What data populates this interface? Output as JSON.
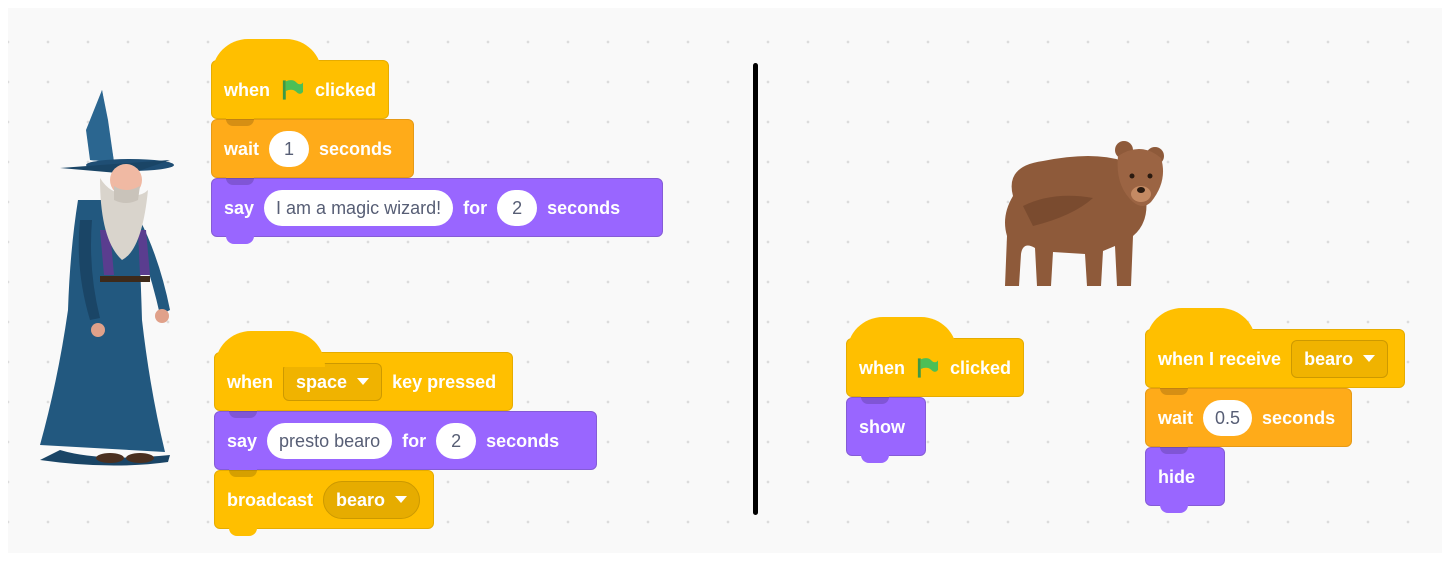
{
  "left_sprite": "wizard",
  "right_sprite": "bear",
  "scripts": {
    "wizard_flag": {
      "hat": {
        "pre": "when",
        "post": "clicked",
        "icon": "green-flag-icon"
      },
      "wait": {
        "label": "wait",
        "value": "1",
        "suffix": "seconds"
      },
      "say": {
        "label": "say",
        "text": "I am a magic wizard!",
        "for": "for",
        "secs": "2",
        "suffix": "seconds"
      }
    },
    "wizard_key": {
      "hat": {
        "pre": "when",
        "key": "space",
        "post": "key pressed"
      },
      "say": {
        "label": "say",
        "text": "presto bearo",
        "for": "for",
        "secs": "2",
        "suffix": "seconds"
      },
      "broadcast": {
        "label": "broadcast",
        "message": "bearo"
      }
    },
    "bear_flag": {
      "hat": {
        "pre": "when",
        "post": "clicked",
        "icon": "green-flag-icon"
      },
      "show": {
        "label": "show"
      }
    },
    "bear_receive": {
      "hat": {
        "label": "when I receive",
        "message": "bearo"
      },
      "wait": {
        "label": "wait",
        "value": "0.5",
        "suffix": "seconds"
      },
      "hide": {
        "label": "hide"
      }
    }
  },
  "colors": {
    "events": "#ffbf00",
    "control": "#ffab19",
    "looks": "#9966ff",
    "flag": "#4cbf56"
  }
}
